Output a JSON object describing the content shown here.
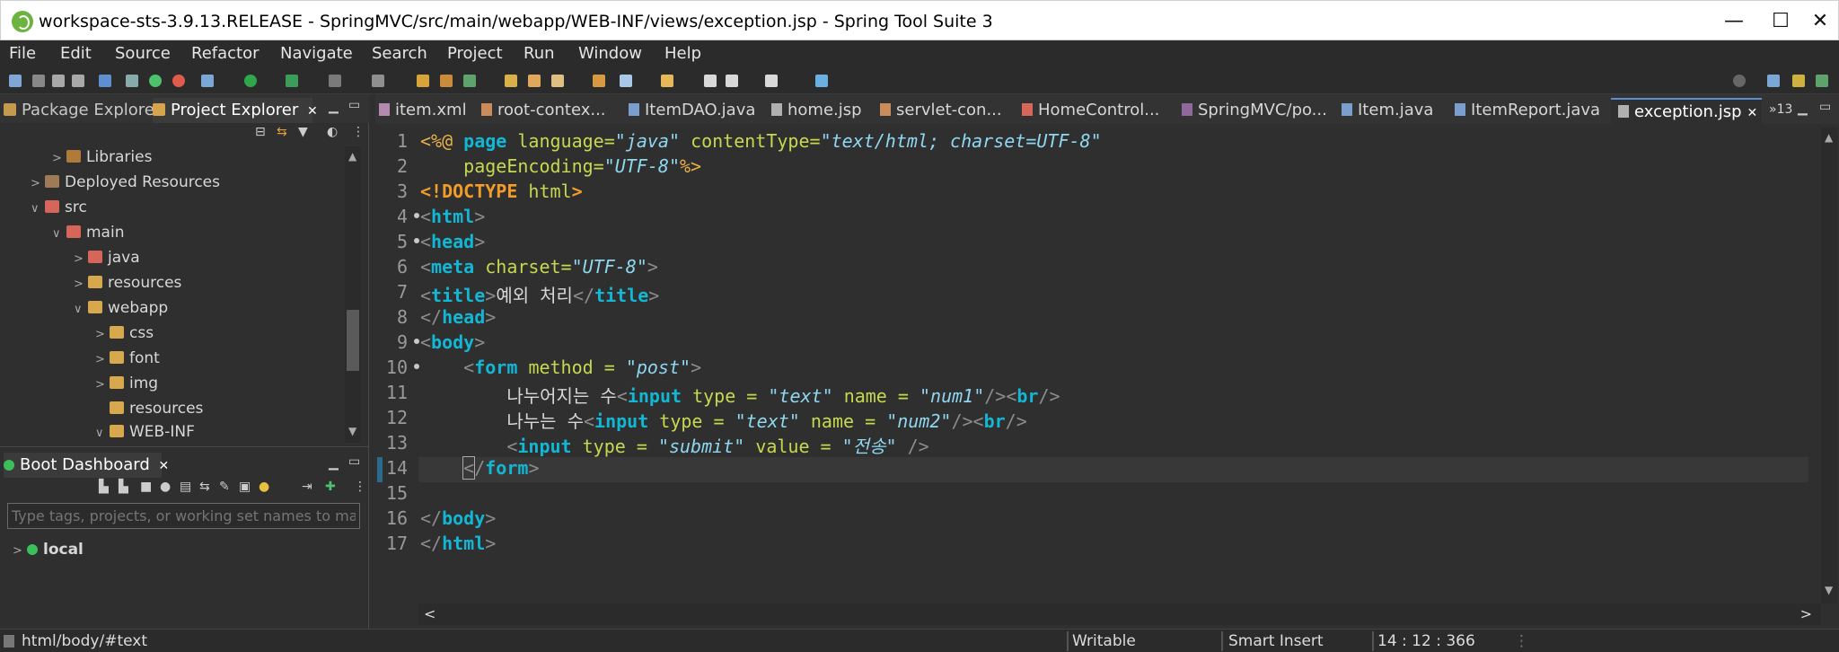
{
  "window": {
    "title": "workspace-sts-3.9.13.RELEASE - SpringMVC/src/main/webapp/WEB-INF/views/exception.jsp - Spring Tool Suite 3",
    "minimize": "—",
    "maximize": "☐",
    "close": "✕"
  },
  "menu": [
    "File",
    "Edit",
    "Source",
    "Refactor",
    "Navigate",
    "Search",
    "Project",
    "Run",
    "Window",
    "Help"
  ],
  "left_tabs": {
    "package_explorer": "Package Explorer",
    "project_explorer": "Project Explorer",
    "close": "✕"
  },
  "tree": [
    {
      "label": "Libraries",
      "chevron": ">",
      "icon": "libraries-icon"
    },
    {
      "label": "Deployed Resources",
      "chevron": ">",
      "icon": "folder-icon"
    },
    {
      "label": "src",
      "chevron": "∨",
      "icon": "source-folder-icon"
    },
    {
      "label": "main",
      "chevron": "∨",
      "icon": "source-folder-icon"
    },
    {
      "label": "java",
      "chevron": ">",
      "icon": "source-folder-icon"
    },
    {
      "label": "resources",
      "chevron": ">",
      "icon": "folder-icon"
    },
    {
      "label": "webapp",
      "chevron": "∨",
      "icon": "folder-icon"
    },
    {
      "label": "css",
      "chevron": ">",
      "icon": "folder-icon"
    },
    {
      "label": "font",
      "chevron": ">",
      "icon": "folder-icon"
    },
    {
      "label": "img",
      "chevron": ">",
      "icon": "folder-icon"
    },
    {
      "label": "resources",
      "chevron": "",
      "icon": "folder-icon"
    },
    {
      "label": "WEB-INF",
      "chevron": "∨",
      "icon": "folder-icon"
    }
  ],
  "boot": {
    "title": "Boot Dashboard",
    "close": "✕",
    "filter_placeholder": "Type tags, projects, or working set names to ma",
    "local": "local",
    "local_chevron": ">"
  },
  "editor_tabs": [
    {
      "label": "item.xml",
      "active": false
    },
    {
      "label": "root-contex...",
      "active": false
    },
    {
      "label": "ItemDAO.java",
      "active": false
    },
    {
      "label": "home.jsp",
      "active": false
    },
    {
      "label": "servlet-con...",
      "active": false
    },
    {
      "label": "HomeControl...",
      "active": false
    },
    {
      "label": "SpringMVC/po...",
      "active": false
    },
    {
      "label": "Item.java",
      "active": false
    },
    {
      "label": "ItemReport.java",
      "active": false
    },
    {
      "label": "exception.jsp",
      "active": true
    }
  ],
  "editor_tab_close": "✕",
  "overflow_tabs": "»13",
  "code": {
    "line_numbers": [
      "1",
      "2",
      "3",
      "4",
      "5",
      "6",
      "7",
      "8",
      "9",
      "10",
      "11",
      "12",
      "13",
      "14",
      "15",
      "16",
      "17"
    ],
    "current_line": 14,
    "fold_markers": [
      4,
      5,
      9,
      10
    ]
  },
  "status": {
    "path": "html/body/#text",
    "writable": "Writable",
    "insert_mode": "Smart Insert",
    "position": "14 : 12 : 366"
  },
  "colors": {
    "tag": "#11b7d4",
    "attr": "#c7d84f",
    "value": "#8fd7f0",
    "jsp": "#e8b04b",
    "doctype": "#f39c2a",
    "background": "#2f2f2f"
  }
}
